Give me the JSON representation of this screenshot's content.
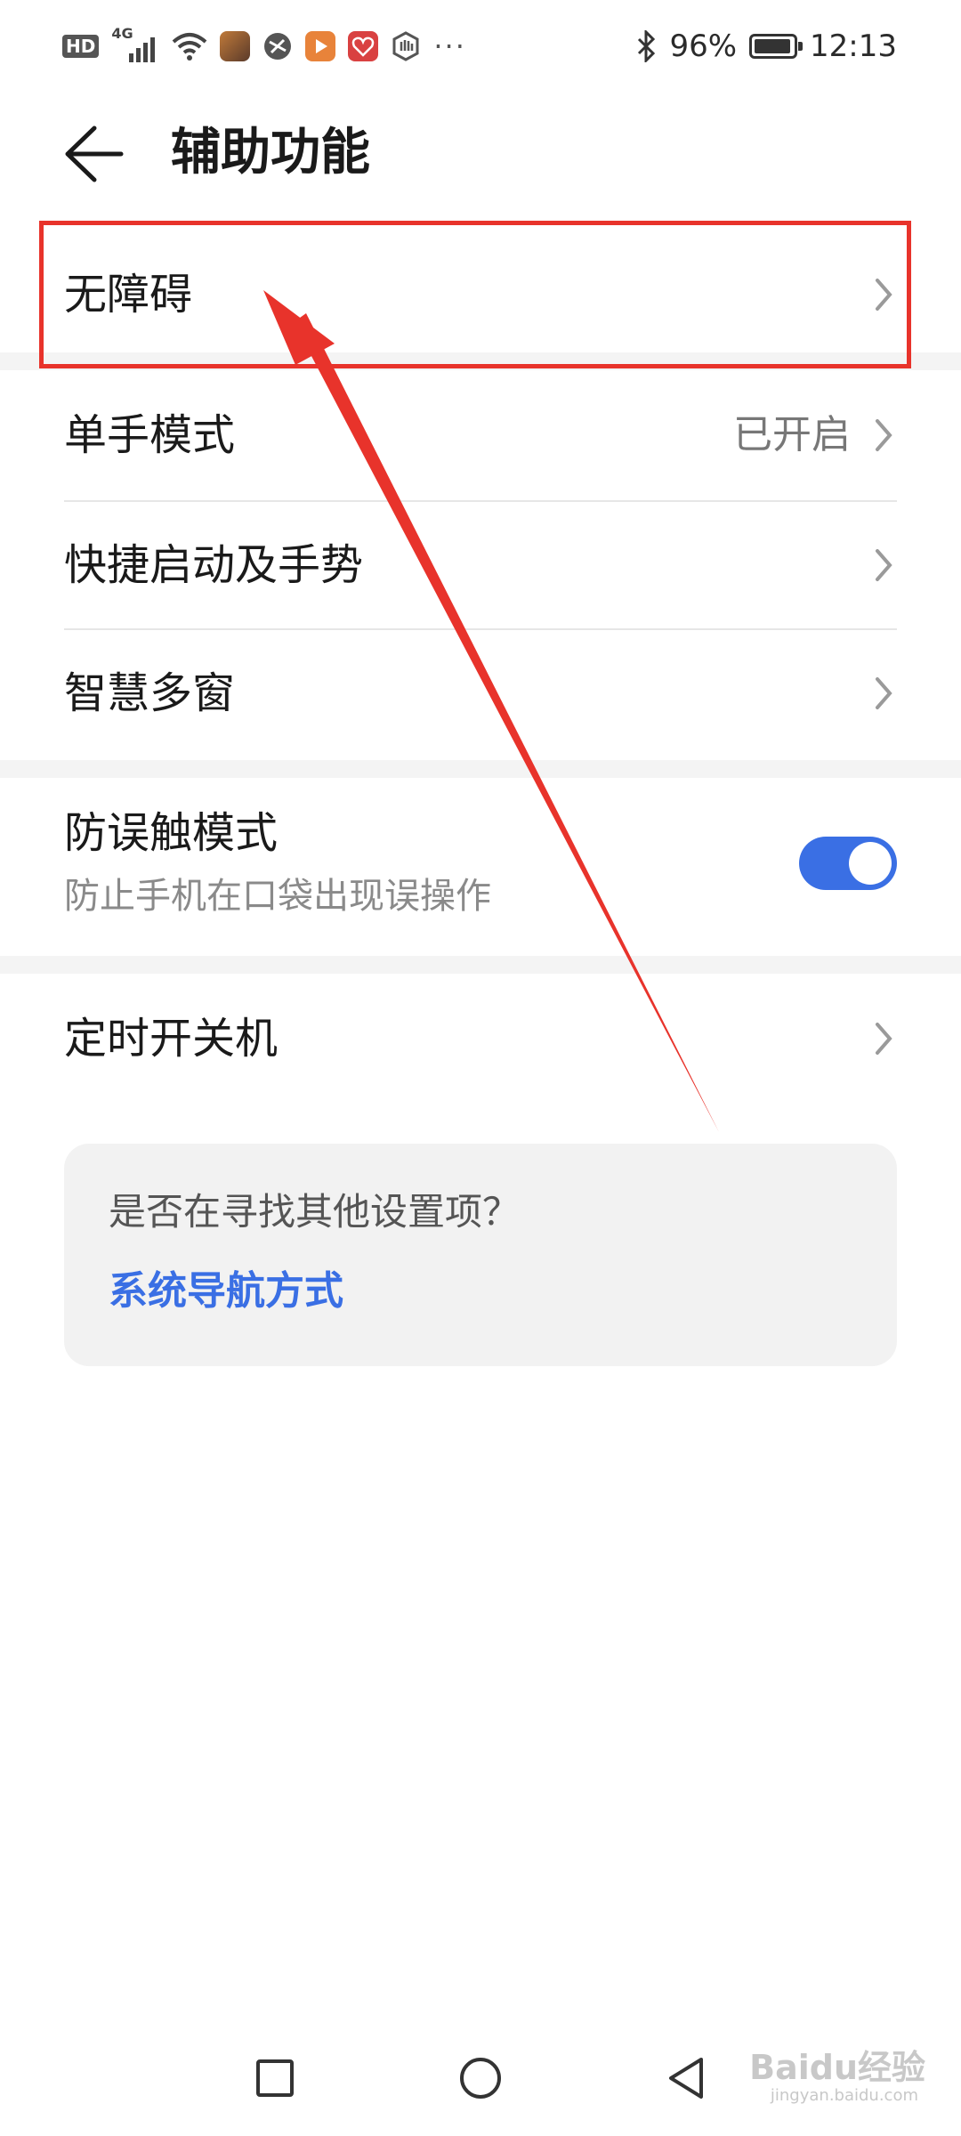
{
  "status_bar": {
    "hd_badge": "HD",
    "network": "4G",
    "battery_percent": "96%",
    "battery_level": 0.96,
    "time": "12:13",
    "more_indicator": "···",
    "icons": [
      "hd-icon",
      "signal-icon",
      "wifi-icon",
      "game-app-icon",
      "app-icon",
      "video-app-icon",
      "heart-app-icon",
      "hand-app-icon",
      "bluetooth-icon",
      "battery-icon"
    ]
  },
  "header": {
    "title": "辅助功能",
    "back_icon": "back-arrow-icon"
  },
  "list": {
    "accessibility": {
      "label": "无障碍"
    },
    "one_hand": {
      "label": "单手模式",
      "value": "已开启"
    },
    "shortcuts": {
      "label": "快捷启动及手势"
    },
    "multi_window": {
      "label": "智慧多窗"
    },
    "pocket_mode": {
      "label": "防误触模式",
      "subtitle": "防止手机在口袋出现误操作",
      "enabled": true
    },
    "scheduled_power": {
      "label": "定时开关机"
    }
  },
  "suggestion_card": {
    "question": "是否在寻找其他设置项？",
    "link": "系统导航方式"
  },
  "nav_bar": {
    "icons": [
      "recent-apps-icon",
      "home-icon",
      "back-triangle-icon"
    ]
  },
  "watermark": {
    "text": "Baidu经验",
    "url": "jingyan.baidu.com"
  },
  "colors": {
    "accent": "#3a6fe4",
    "highlight": "#e8332b"
  }
}
